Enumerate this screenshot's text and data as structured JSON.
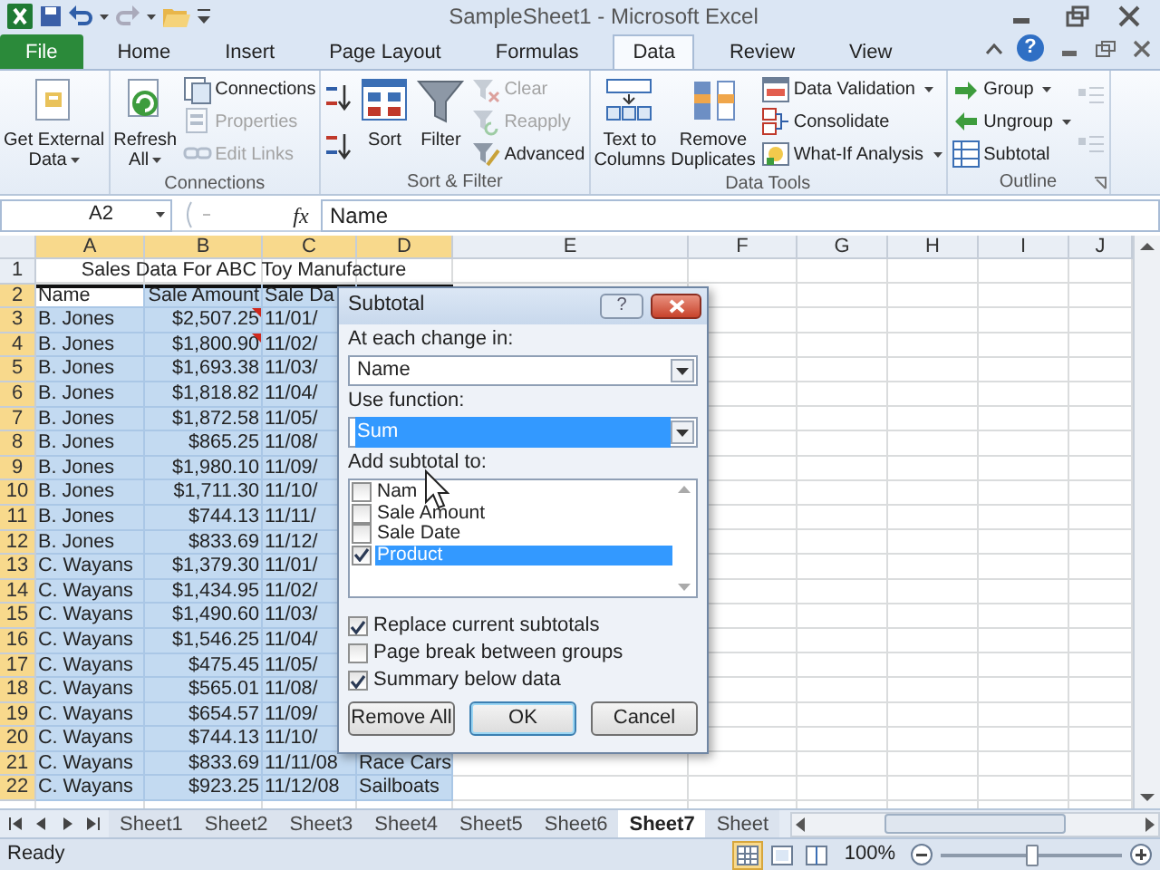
{
  "window": {
    "title": "SampleSheet1 - Microsoft Excel"
  },
  "ribbon_tabs": [
    {
      "label": "File",
      "kind": "file",
      "selected": false
    },
    {
      "label": "Home",
      "kind": "tab",
      "selected": false
    },
    {
      "label": "Insert",
      "kind": "tab",
      "selected": false
    },
    {
      "label": "Page Layout",
      "kind": "tab",
      "selected": false
    },
    {
      "label": "Formulas",
      "kind": "tab",
      "selected": false
    },
    {
      "label": "Data",
      "kind": "tab",
      "selected": true
    },
    {
      "label": "Review",
      "kind": "tab",
      "selected": false
    },
    {
      "label": "View",
      "kind": "tab",
      "selected": false
    }
  ],
  "help_label": "?",
  "ribbon_groups": [
    {
      "launcher": false,
      "items": [
        {
          "kind": "large",
          "lines": [
            "Get External",
            "Data"
          ],
          "dropdown": true,
          "disabled": false
        }
      ]
    },
    {
      "title": "Connections",
      "launcher": false,
      "items": [
        {
          "kind": "large",
          "lines": [
            "Refresh",
            "All"
          ],
          "dropdown": true,
          "disabled": false
        },
        {
          "kind": "small",
          "lines": [
            "Connections"
          ],
          "dropdown": false,
          "disabled": false
        },
        {
          "kind": "small",
          "lines": [
            "Properties"
          ],
          "dropdown": false,
          "disabled": true
        },
        {
          "kind": "small",
          "lines": [
            "Edit Links"
          ],
          "dropdown": false,
          "disabled": true
        }
      ]
    },
    {
      "title": "Sort & Filter",
      "launcher": false,
      "items": [
        {
          "kind": "icon",
          "dropdown": false,
          "disabled": false
        },
        {
          "kind": "icon",
          "dropdown": false,
          "disabled": false
        },
        {
          "kind": "large",
          "lines": [
            "Sort"
          ],
          "dropdown": false,
          "disabled": false
        },
        {
          "kind": "large",
          "lines": [
            "Filter"
          ],
          "dropdown": false,
          "disabled": false
        },
        {
          "kind": "small",
          "lines": [
            "Clear"
          ],
          "dropdown": false,
          "disabled": true
        },
        {
          "kind": "small",
          "lines": [
            "Reapply"
          ],
          "dropdown": false,
          "disabled": true
        },
        {
          "kind": "small",
          "lines": [
            "Advanced"
          ],
          "dropdown": false,
          "disabled": false
        }
      ]
    },
    {
      "title": "Data Tools",
      "launcher": false,
      "items": [
        {
          "kind": "large",
          "lines": [
            "Text to",
            "Columns"
          ],
          "dropdown": false,
          "disabled": false
        },
        {
          "kind": "large",
          "lines": [
            "Remove",
            "Duplicates"
          ],
          "dropdown": false,
          "disabled": false
        },
        {
          "kind": "small",
          "lines": [
            "Data Validation"
          ],
          "dropdown": true,
          "disabled": false
        },
        {
          "kind": "small",
          "lines": [
            "Consolidate"
          ],
          "dropdown": false,
          "disabled": false
        },
        {
          "kind": "small",
          "lines": [
            "What-If Analysis"
          ],
          "dropdown": true,
          "disabled": false
        }
      ]
    },
    {
      "title": "Outline",
      "launcher": true,
      "items": [
        {
          "kind": "small",
          "lines": [
            "Group"
          ],
          "dropdown": true,
          "disabled": false
        },
        {
          "kind": "small",
          "lines": [
            "Ungroup"
          ],
          "dropdown": true,
          "disabled": false
        },
        {
          "kind": "small",
          "lines": [
            "Subtotal"
          ],
          "dropdown": false,
          "disabled": false
        },
        {
          "kind": "icon",
          "dropdown": false,
          "disabled": true
        },
        {
          "kind": "icon",
          "dropdown": false,
          "disabled": true
        }
      ]
    }
  ],
  "formula_bar": {
    "name_box": "A2",
    "function_label": "fx",
    "content": "Name"
  },
  "grid": {
    "columns": [
      {
        "label": "A",
        "selected": true
      },
      {
        "label": "B",
        "selected": true
      },
      {
        "label": "C",
        "selected": true
      },
      {
        "label": "D",
        "selected": true
      },
      {
        "label": "E",
        "selected": false
      },
      {
        "label": "F",
        "selected": false
      },
      {
        "label": "G",
        "selected": false
      },
      {
        "label": "H",
        "selected": false
      },
      {
        "label": "I",
        "selected": false
      },
      {
        "label": "J",
        "selected": false
      }
    ],
    "rows": [
      {
        "header": "1",
        "selected": false,
        "cells": [
          {
            "text": "Sales Data For ABC Toy Manufacture",
            "kind": "merged"
          }
        ]
      },
      {
        "header": "2",
        "selected": true,
        "cells": [
          {
            "text": "Name",
            "active": true
          },
          "Sale Amount",
          "Sale Da"
        ]
      },
      {
        "header": "3",
        "selected": true,
        "cells": [
          "B. Jones",
          {
            "text": "$2,507.25",
            "comment": true
          },
          "11/01/"
        ]
      },
      {
        "header": "4",
        "selected": true,
        "cells": [
          "B. Jones",
          {
            "text": "$1,800.90",
            "comment": true
          },
          "11/02/"
        ]
      },
      {
        "header": "5",
        "selected": true,
        "cells": [
          "B. Jones",
          "$1,693.38",
          "11/03/"
        ]
      },
      {
        "header": "6",
        "selected": true,
        "cells": [
          "B. Jones",
          "$1,818.82",
          "11/04/"
        ]
      },
      {
        "header": "7",
        "selected": true,
        "cells": [
          "B. Jones",
          "$1,872.58",
          "11/05/"
        ]
      },
      {
        "header": "8",
        "selected": true,
        "cells": [
          "B. Jones",
          "$865.25",
          "11/08/"
        ]
      },
      {
        "header": "9",
        "selected": true,
        "cells": [
          "B. Jones",
          "$1,980.10",
          "11/09/"
        ]
      },
      {
        "header": "10",
        "selected": true,
        "cells": [
          "B. Jones",
          "$1,711.30",
          "11/10/"
        ]
      },
      {
        "header": "11",
        "selected": true,
        "cells": [
          "B. Jones",
          "$744.13",
          "11/11/"
        ]
      },
      {
        "header": "12",
        "selected": true,
        "cells": [
          "B. Jones",
          "$833.69",
          "11/12/"
        ]
      },
      {
        "header": "13",
        "selected": true,
        "cells": [
          "C. Wayans",
          "$1,379.30",
          "11/01/"
        ]
      },
      {
        "header": "14",
        "selected": true,
        "cells": [
          "C. Wayans",
          "$1,434.95",
          "11/02/"
        ]
      },
      {
        "header": "15",
        "selected": true,
        "cells": [
          "C. Wayans",
          "$1,490.60",
          "11/03/"
        ]
      },
      {
        "header": "16",
        "selected": true,
        "cells": [
          "C. Wayans",
          "$1,546.25",
          "11/04/"
        ]
      },
      {
        "header": "17",
        "selected": true,
        "cells": [
          "C. Wayans",
          "$475.45",
          "11/05/"
        ]
      },
      {
        "header": "18",
        "selected": true,
        "cells": [
          "C. Wayans",
          "$565.01",
          "11/08/"
        ]
      },
      {
        "header": "19",
        "selected": true,
        "cells": [
          "C. Wayans",
          "$654.57",
          "11/09/"
        ]
      },
      {
        "header": "20",
        "selected": true,
        "cells": [
          "C. Wayans",
          "$744.13",
          "11/10/"
        ]
      },
      {
        "header": "21",
        "selected": true,
        "cells": [
          "C. Wayans",
          "$833.69",
          "11/11/08",
          "Race Cars"
        ]
      },
      {
        "header": "22",
        "selected": true,
        "cells": [
          "C. Wayans",
          "$923.25",
          "11/12/08",
          "Sailboats"
        ]
      }
    ]
  },
  "dialog": {
    "title": "Subtotal",
    "help_label": "?",
    "change_label": "At each change in:",
    "change_value": "Name",
    "function_label": "Use function:",
    "function_value": "Sum",
    "function_focused": true,
    "fields_label": "Add subtotal to:",
    "fields": [
      {
        "label": "Nam",
        "checked": false,
        "selected": false
      },
      {
        "label": "Sale Amount",
        "checked": false,
        "selected": false
      },
      {
        "label": "Sale Date",
        "checked": false,
        "selected": false
      },
      {
        "label": "Product",
        "checked": true,
        "selected": true
      }
    ],
    "options": [
      {
        "label": "Replace current subtotals",
        "checked": true
      },
      {
        "label": "Page break between groups",
        "checked": false
      },
      {
        "label": "Summary below data",
        "checked": true
      }
    ],
    "buttons": [
      {
        "label": "Remove All",
        "default": false
      },
      {
        "label": "OK",
        "default": true
      },
      {
        "label": "Cancel",
        "default": false
      }
    ]
  },
  "sheet_tabs": [
    {
      "label": "Sheet1",
      "selected": false
    },
    {
      "label": "Sheet2",
      "selected": false
    },
    {
      "label": "Sheet3",
      "selected": false
    },
    {
      "label": "Sheet4",
      "selected": false
    },
    {
      "label": "Sheet5",
      "selected": false
    },
    {
      "label": "Sheet6",
      "selected": false
    },
    {
      "label": "Sheet7",
      "selected": true
    },
    {
      "label": "Sheet",
      "selected": false
    }
  ],
  "status_bar": {
    "text": "Ready",
    "views": [
      {
        "kind": "normal",
        "selected": true
      },
      {
        "kind": "layout",
        "selected": false
      },
      {
        "kind": "break",
        "selected": false
      }
    ],
    "zoom": "100%",
    "zoom_slider": {
      "level": 0.5
    }
  }
}
